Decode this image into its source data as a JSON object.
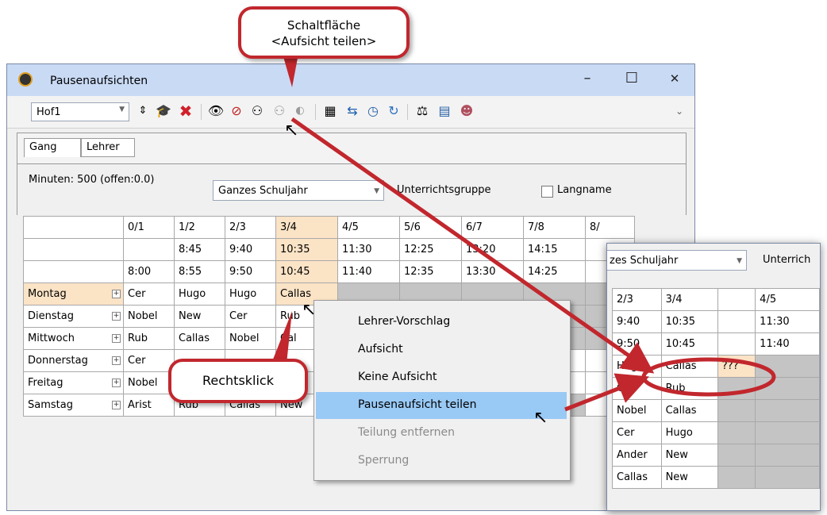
{
  "window": {
    "title": "Pausenaufsichten",
    "minimize": "–",
    "maximize": "☐",
    "close": "✕"
  },
  "toolbar": {
    "location_value": "Hof1",
    "icons": [
      "spin-icon",
      "graduation-cap-icon",
      "delete-x-icon",
      "eye-icon",
      "eye-off-icon",
      "share-supervision-icon",
      "share-remove-icon",
      "lock-icon",
      "calculator-icon",
      "transfer-icon",
      "clock-icon",
      "cycle-icon",
      "balance-icon",
      "report-icon",
      "person-icon"
    ],
    "overflow": "⌄"
  },
  "tabs": [
    "Gang",
    "Lehrer"
  ],
  "options": {
    "minutes": "Minuten: 500 (offen:0.0)",
    "period_value": "Ganzes Schuljahr",
    "unterrichtsgruppe": "Unterrichtsgruppe",
    "langname": "Langname"
  },
  "grid": {
    "periods": [
      "0/1",
      "1/2",
      "2/3",
      "3/4",
      "4/5",
      "5/6",
      "6/7",
      "7/8",
      "8/"
    ],
    "start_times": [
      "",
      "8:45",
      "9:40",
      "10:35",
      "11:30",
      "12:25",
      "13:20",
      "14:15",
      ""
    ],
    "end_times": [
      "8:00",
      "8:55",
      "9:50",
      "10:45",
      "11:40",
      "12:35",
      "13:30",
      "14:25",
      ""
    ],
    "days": [
      {
        "name": "Montag",
        "cells": [
          "Cer",
          "Hugo",
          "Hugo",
          "Callas",
          "",
          "",
          "",
          "",
          ""
        ]
      },
      {
        "name": "Dienstag",
        "cells": [
          "Nobel",
          "New",
          "Cer",
          "Rub",
          "",
          "",
          "",
          "",
          ""
        ]
      },
      {
        "name": "Mittwoch",
        "cells": [
          "Rub",
          "Callas",
          "Nobel",
          "Cal",
          "",
          "",
          "",
          "",
          ""
        ]
      },
      {
        "name": "Donnerstag",
        "cells": [
          "Cer",
          "",
          "",
          "",
          "",
          "",
          "",
          "",
          ""
        ]
      },
      {
        "name": "Freitag",
        "cells": [
          "Nobel",
          "",
          "",
          "",
          "",
          "",
          "",
          "",
          ""
        ]
      },
      {
        "name": "Samstag",
        "cells": [
          "Arist",
          "Rub",
          "Callas",
          "New",
          "",
          "",
          "",
          "",
          ""
        ]
      }
    ]
  },
  "context_menu": {
    "items": [
      {
        "label": "Lehrer-Vorschlag",
        "enabled": true
      },
      {
        "label": "Aufsicht",
        "enabled": true
      },
      {
        "label": "Keine Aufsicht",
        "enabled": true
      },
      {
        "label": "Pausenaufsicht teilen",
        "enabled": true,
        "selected": true
      },
      {
        "label": "Teilung entfernen",
        "enabled": false
      },
      {
        "label": "Sperrung",
        "enabled": false
      }
    ]
  },
  "zoom": {
    "period_value": "zes Schuljahr",
    "group_label": "Unterrich",
    "header": [
      "2/3",
      "3/4",
      "",
      "4/5"
    ],
    "row1": [
      "9:40",
      "10:35",
      "",
      "11:30"
    ],
    "row2": [
      "9:50",
      "10:45",
      "",
      "11:40"
    ],
    "rows": [
      [
        "Hugo",
        "Callas",
        "???"
      ],
      [
        "Cer",
        "Rub",
        ""
      ],
      [
        "Nobel",
        "Callas",
        ""
      ],
      [
        "Cer",
        "Hugo",
        ""
      ],
      [
        "Ander",
        "New",
        ""
      ],
      [
        "Callas",
        "New",
        ""
      ]
    ]
  },
  "callouts": {
    "top_line1": "Schaltfläche",
    "top_line2": "<Aufsicht teilen>",
    "right_click": "Rechtsklick"
  },
  "colors": {
    "callout_border": "#c1272d",
    "highlight_cell": "#fbe3c6",
    "menu_selection": "#99c9f5"
  }
}
